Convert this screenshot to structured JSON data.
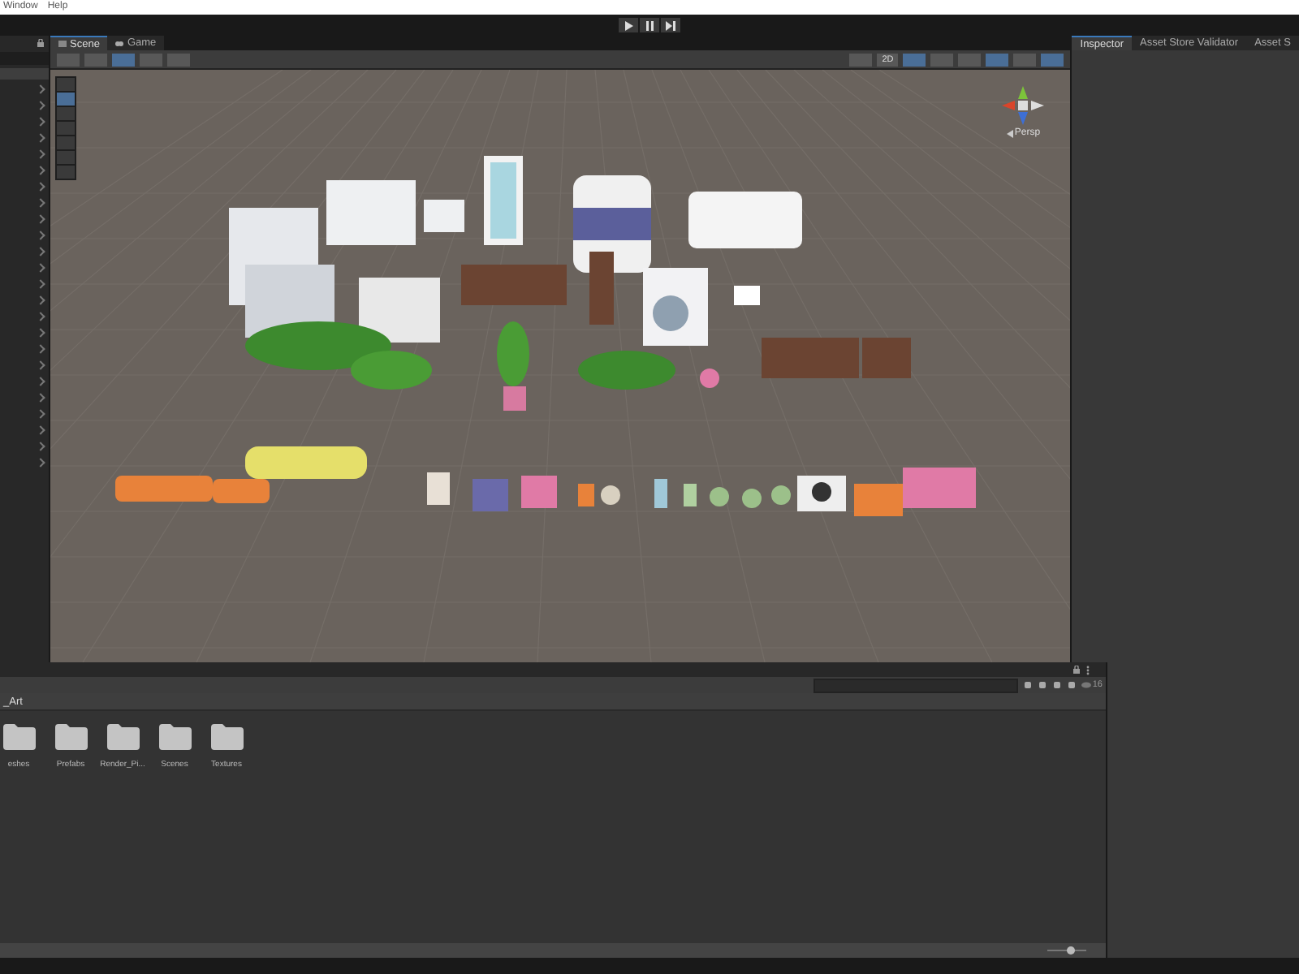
{
  "menu": [
    {
      "label": "Window"
    },
    {
      "label": "Help"
    }
  ],
  "scene_view": {
    "tabs": [
      {
        "label": "Scene",
        "selected": true
      },
      {
        "label": "Game",
        "selected": false
      }
    ],
    "mode_label": "2D",
    "projection_label": "Persp"
  },
  "inspector": {
    "tabs": [
      {
        "label": "Inspector",
        "selected": true
      },
      {
        "label": "Asset Store Validator",
        "selected": false
      },
      {
        "label": "Asset S",
        "selected": false
      }
    ]
  },
  "project": {
    "breadcrumb": "_Art",
    "visible_count": "16",
    "folders": [
      {
        "label": "eshes"
      },
      {
        "label": "Prefabs"
      },
      {
        "label": "Render_Pi..."
      },
      {
        "label": "Scenes"
      },
      {
        "label": "Textures"
      }
    ],
    "zoom_slider": {
      "level": 0.6
    }
  }
}
